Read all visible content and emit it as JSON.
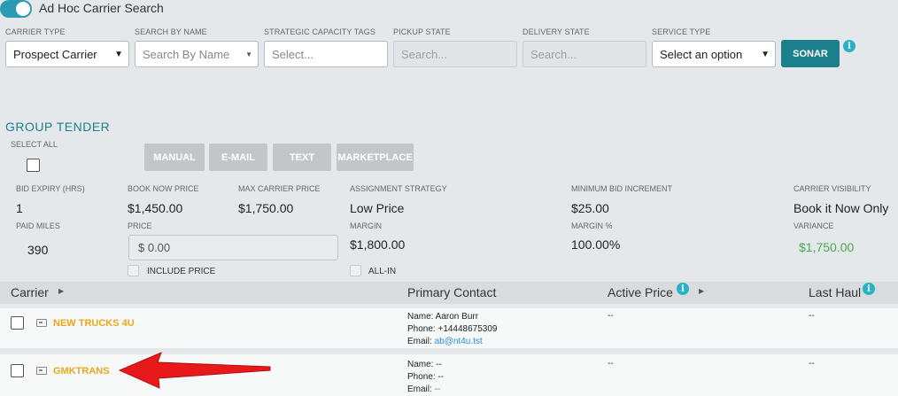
{
  "header": {
    "title": "Ad Hoc Carrier Search"
  },
  "filters": {
    "carrier_type": {
      "label": "CARRIER TYPE",
      "value": "Prospect Carrier"
    },
    "search_by_name": {
      "label": "SEARCH BY NAME",
      "placeholder": "Search By Name"
    },
    "capacity_tags": {
      "label": "STRATEGIC CAPACITY TAGS",
      "placeholder": "Select..."
    },
    "pickup_state": {
      "label": "PICKUP STATE",
      "placeholder": "Search..."
    },
    "delivery_state": {
      "label": "DELIVERY STATE",
      "placeholder": "Search..."
    },
    "service_type": {
      "label": "SERVICE TYPE",
      "value": "Select an option"
    },
    "sonar_label": "SONAR"
  },
  "group_tender": {
    "title": "GROUP TENDER",
    "select_all": "SELECT ALL",
    "buttons": [
      "MANUAL",
      "E-MAIL",
      "TEXT",
      "MARKETPLACE"
    ]
  },
  "summary": {
    "bid_expiry": {
      "label": "BID EXPIRY (HRS)",
      "value": "1"
    },
    "book_now": {
      "label": "BOOK NOW PRICE",
      "value": "$1,450.00"
    },
    "max_carrier": {
      "label": "MAX CARRIER PRICE",
      "value": "$1,750.00"
    },
    "assignment": {
      "label": "ASSIGNMENT STRATEGY",
      "value": "Low Price"
    },
    "min_bid": {
      "label": "MINIMUM BID INCREMENT",
      "value": "$25.00"
    },
    "visibility": {
      "label": "CARRIER VISIBILITY",
      "value": "Book it Now Only"
    },
    "paid_miles": {
      "label": "PAID MILES",
      "value": "390"
    },
    "price": {
      "label": "PRICE",
      "value": "$ 0.00"
    },
    "margin": {
      "label": "MARGIN",
      "value": "$1,800.00"
    },
    "margin_pct": {
      "label": "MARGIN %",
      "value": "100.00%"
    },
    "variance": {
      "label": "VARIANCE",
      "value": "$1,750.00"
    },
    "include_price": "INCLUDE PRICE",
    "all_in": "ALL-IN"
  },
  "table": {
    "columns": [
      "Carrier",
      "Primary Contact",
      "Active Price",
      "Last Haul"
    ],
    "rows": [
      {
        "carrier": "NEW TRUCKS 4U",
        "name": "Name:  Aaron Burr",
        "phone": "Phone:  +14448675309",
        "email_label": "Email:",
        "email": "ab@nt4u.tst",
        "active_price": "--",
        "last_haul": "--"
      },
      {
        "carrier": "GMKTRANS",
        "name": "Name:  --",
        "phone": "Phone:  --",
        "email_label": "Email:",
        "email": "--",
        "active_price": "--",
        "last_haul": "--"
      }
    ]
  },
  "colors": {
    "accent": "#1c7f8c",
    "carrier_name": "#e9a81c",
    "arrow": "#e8191b",
    "variance": "#4ca84c"
  }
}
